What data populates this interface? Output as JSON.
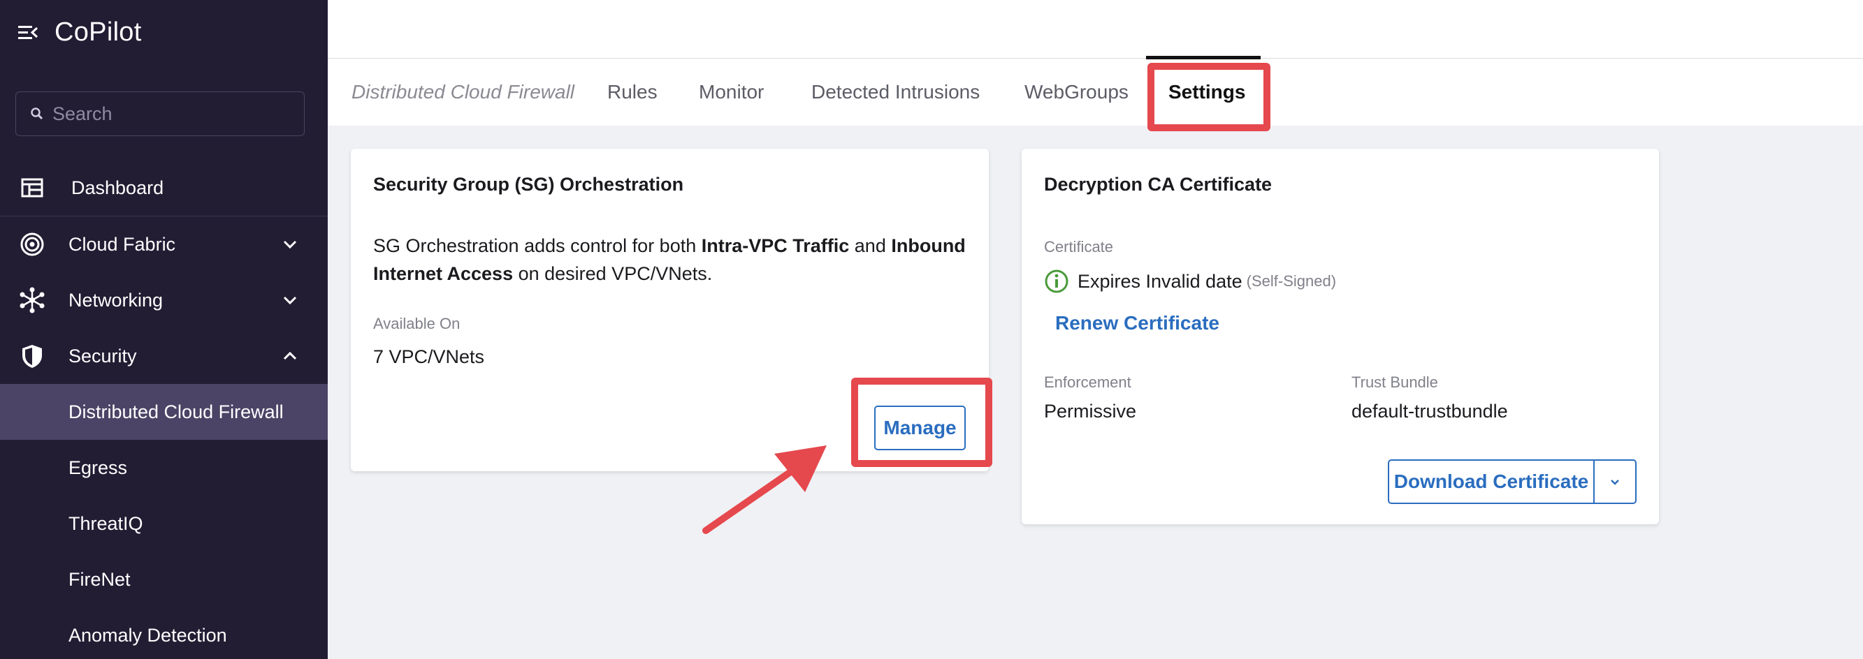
{
  "app": {
    "title": "CoPilot"
  },
  "search": {
    "placeholder": "Search"
  },
  "sidebar": {
    "items": [
      {
        "label": "Dashboard",
        "icon": "dashboard-icon"
      },
      {
        "label": "Cloud Fabric",
        "icon": "cloud-fabric-icon",
        "expanded": false
      },
      {
        "label": "Networking",
        "icon": "networking-icon",
        "expanded": false
      },
      {
        "label": "Security",
        "icon": "shield-icon",
        "expanded": true
      }
    ],
    "sub_items": [
      {
        "label": "Distributed Cloud Firewall",
        "active": true
      },
      {
        "label": "Egress"
      },
      {
        "label": "ThreatIQ"
      },
      {
        "label": "FireNet"
      },
      {
        "label": "Anomaly Detection"
      }
    ]
  },
  "tabs": {
    "breadcrumb": "Distributed Cloud Firewall",
    "items": [
      "Rules",
      "Monitor",
      "Detected Intrusions",
      "WebGroups",
      "Settings"
    ],
    "active": "Settings"
  },
  "sg_card": {
    "title": "Security Group (SG) Orchestration",
    "desc_1": "SG Orchestration adds control for both ",
    "desc_bold_1": "Intra-VPC Traffic",
    "desc_2": " and ",
    "desc_bold_2": "Inbound Internet Access",
    "desc_3": " on desired VPC/VNets.",
    "available_label": "Available On",
    "available_value": "7 VPC/VNets",
    "manage_label": "Manage"
  },
  "ca_card": {
    "title": "Decryption CA Certificate",
    "certificate_label": "Certificate",
    "expires_text": "Expires Invalid date",
    "self_signed": "(Self-Signed)",
    "renew_label": "Renew Certificate",
    "enforcement_label": "Enforcement",
    "enforcement_value": "Permissive",
    "trust_label": "Trust Bundle",
    "trust_value": "default-trustbundle",
    "download_label": "Download Certificate"
  },
  "colors": {
    "sidebar_bg": "#221d33",
    "sidebar_active": "#4b4466",
    "accent": "#2a6dbf",
    "highlight": "#e5484d",
    "status_ok": "#4a9a3a"
  }
}
